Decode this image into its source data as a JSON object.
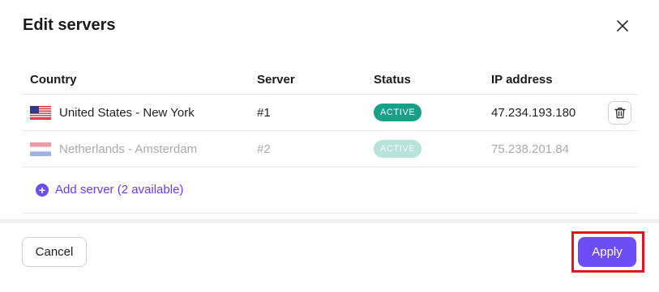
{
  "dialog": {
    "title": "Edit servers",
    "close_icon": "close-icon"
  },
  "table": {
    "headers": {
      "country": "Country",
      "server": "Server",
      "status": "Status",
      "ip": "IP address"
    },
    "rows": [
      {
        "flag": "us-flag-icon",
        "country": "United States - New York",
        "server": "#1",
        "status": "ACTIVE",
        "ip": "47.234.193.180",
        "disabled": false,
        "action_icon": "trash-icon"
      },
      {
        "flag": "nl-flag-icon",
        "country": "Netherlands - Amsterdam",
        "server": "#2",
        "status": "ACTIVE",
        "ip": "75.238.201.84",
        "disabled": true
      }
    ]
  },
  "add_server": {
    "label": "Add server (2 available)",
    "icon": "plus-circle-icon"
  },
  "footer": {
    "cancel_label": "Cancel",
    "apply_label": "Apply"
  },
  "colors": {
    "accent": "#6c4df6",
    "status_active": "#17a087",
    "highlight": "#e3141b"
  }
}
